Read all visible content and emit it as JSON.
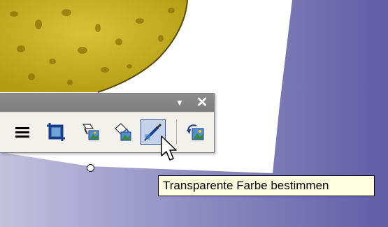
{
  "tooltip": {
    "text": "Transparente Farbe bestimmen"
  },
  "toolbar": {
    "dropdown_glyph": "▼",
    "close_glyph": "✕",
    "tools": [
      {
        "icon": "line-style-icon"
      },
      {
        "icon": "crop-icon"
      },
      {
        "icon": "format-picture-icon"
      },
      {
        "icon": "recolor-picture-icon"
      },
      {
        "icon": "set-transparent-color-icon",
        "active": true
      },
      {
        "icon": "reset-picture-icon"
      }
    ]
  },
  "colors": {
    "slide_purple": "#8a86be",
    "toolbar_title": "#8a8a8a",
    "toolbar_body": "#f2f1ec",
    "active_tool": "#c4d2ea",
    "tooltip_bg": "#ffffe1"
  }
}
